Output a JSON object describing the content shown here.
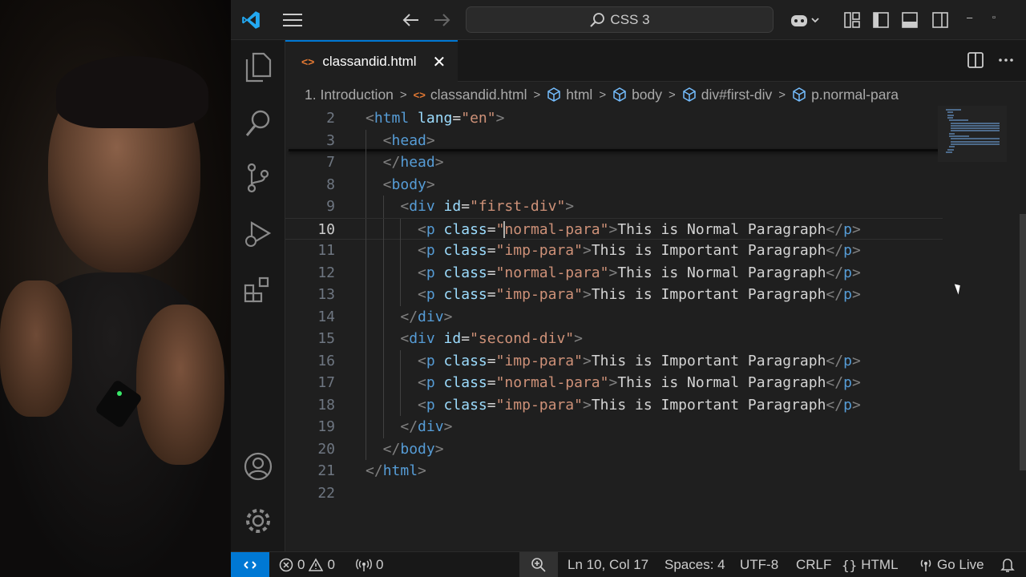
{
  "titlebar": {
    "search_text": "CSS 3"
  },
  "tab": {
    "filename": "classandid.html",
    "close_glyph": "✕"
  },
  "breadcrumb": {
    "folder": "1. Introduction",
    "file": "classandid.html",
    "items": [
      "html",
      "body",
      "div#first-div",
      "p.normal-para"
    ]
  },
  "editor": {
    "current_line": 10,
    "lines": [
      {
        "n": "2",
        "indent": 0,
        "tokens": [
          [
            "b",
            "<"
          ],
          [
            "t",
            "html"
          ],
          [
            "a",
            " lang"
          ],
          [
            "x",
            "="
          ],
          [
            "s",
            "\"en\""
          ],
          [
            "b",
            ">"
          ]
        ]
      },
      {
        "n": "3",
        "indent": 1,
        "tokens": [
          [
            "b",
            "<"
          ],
          [
            "t",
            "head"
          ],
          [
            "b",
            ">"
          ]
        ]
      },
      {
        "n": "7",
        "indent": 1,
        "tokens": [
          [
            "b",
            "</"
          ],
          [
            "t",
            "head"
          ],
          [
            "b",
            ">"
          ]
        ]
      },
      {
        "n": "8",
        "indent": 1,
        "tokens": [
          [
            "b",
            "<"
          ],
          [
            "t",
            "body"
          ],
          [
            "b",
            ">"
          ]
        ]
      },
      {
        "n": "9",
        "indent": 2,
        "tokens": [
          [
            "b",
            "<"
          ],
          [
            "t",
            "div"
          ],
          [
            "a",
            " id"
          ],
          [
            "x",
            "="
          ],
          [
            "s",
            "\"first-div\""
          ],
          [
            "b",
            ">"
          ]
        ]
      },
      {
        "n": "10",
        "indent": 3,
        "tokens": [
          [
            "b",
            "<"
          ],
          [
            "t",
            "p"
          ],
          [
            "a",
            " class"
          ],
          [
            "x",
            "="
          ],
          [
            "s",
            "\""
          ],
          [
            "c",
            ""
          ],
          [
            "s",
            "normal-para\""
          ],
          [
            "b",
            ">"
          ],
          [
            "x",
            "This is Normal Paragraph"
          ],
          [
            "b",
            "</"
          ],
          [
            "t",
            "p"
          ],
          [
            "b",
            ">"
          ]
        ]
      },
      {
        "n": "11",
        "indent": 3,
        "tokens": [
          [
            "b",
            "<"
          ],
          [
            "t",
            "p"
          ],
          [
            "a",
            " class"
          ],
          [
            "x",
            "="
          ],
          [
            "s",
            "\"imp-para\""
          ],
          [
            "b",
            ">"
          ],
          [
            "x",
            "This is Important Paragraph"
          ],
          [
            "b",
            "</"
          ],
          [
            "t",
            "p"
          ],
          [
            "b",
            ">"
          ]
        ]
      },
      {
        "n": "12",
        "indent": 3,
        "tokens": [
          [
            "b",
            "<"
          ],
          [
            "t",
            "p"
          ],
          [
            "a",
            " class"
          ],
          [
            "x",
            "="
          ],
          [
            "s",
            "\"normal-para\""
          ],
          [
            "b",
            ">"
          ],
          [
            "x",
            "This is Normal Paragraph"
          ],
          [
            "b",
            "</"
          ],
          [
            "t",
            "p"
          ],
          [
            "b",
            ">"
          ]
        ]
      },
      {
        "n": "13",
        "indent": 3,
        "tokens": [
          [
            "b",
            "<"
          ],
          [
            "t",
            "p"
          ],
          [
            "a",
            " class"
          ],
          [
            "x",
            "="
          ],
          [
            "s",
            "\"imp-para\""
          ],
          [
            "b",
            ">"
          ],
          [
            "x",
            "This is Important Paragraph"
          ],
          [
            "b",
            "</"
          ],
          [
            "t",
            "p"
          ],
          [
            "b",
            ">"
          ]
        ]
      },
      {
        "n": "14",
        "indent": 2,
        "tokens": [
          [
            "b",
            "</"
          ],
          [
            "t",
            "div"
          ],
          [
            "b",
            ">"
          ]
        ]
      },
      {
        "n": "15",
        "indent": 2,
        "tokens": [
          [
            "b",
            "<"
          ],
          [
            "t",
            "div"
          ],
          [
            "a",
            " id"
          ],
          [
            "x",
            "="
          ],
          [
            "s",
            "\"second-div\""
          ],
          [
            "b",
            ">"
          ]
        ]
      },
      {
        "n": "16",
        "indent": 3,
        "tokens": [
          [
            "b",
            "<"
          ],
          [
            "t",
            "p"
          ],
          [
            "a",
            " class"
          ],
          [
            "x",
            "="
          ],
          [
            "s",
            "\"imp-para\""
          ],
          [
            "b",
            ">"
          ],
          [
            "x",
            "This is Important Paragraph"
          ],
          [
            "b",
            "</"
          ],
          [
            "t",
            "p"
          ],
          [
            "b",
            ">"
          ]
        ]
      },
      {
        "n": "17",
        "indent": 3,
        "tokens": [
          [
            "b",
            "<"
          ],
          [
            "t",
            "p"
          ],
          [
            "a",
            " class"
          ],
          [
            "x",
            "="
          ],
          [
            "s",
            "\"normal-para\""
          ],
          [
            "b",
            ">"
          ],
          [
            "x",
            "This is Normal Paragraph"
          ],
          [
            "b",
            "</"
          ],
          [
            "t",
            "p"
          ],
          [
            "b",
            ">"
          ]
        ]
      },
      {
        "n": "18",
        "indent": 3,
        "tokens": [
          [
            "b",
            "<"
          ],
          [
            "t",
            "p"
          ],
          [
            "a",
            " class"
          ],
          [
            "x",
            "="
          ],
          [
            "s",
            "\"imp-para\""
          ],
          [
            "b",
            ">"
          ],
          [
            "x",
            "This is Important Paragraph"
          ],
          [
            "b",
            "</"
          ],
          [
            "t",
            "p"
          ],
          [
            "b",
            ">"
          ]
        ]
      },
      {
        "n": "19",
        "indent": 2,
        "tokens": [
          [
            "b",
            "</"
          ],
          [
            "t",
            "div"
          ],
          [
            "b",
            ">"
          ]
        ]
      },
      {
        "n": "20",
        "indent": 1,
        "tokens": [
          [
            "b",
            "</"
          ],
          [
            "t",
            "body"
          ],
          [
            "b",
            ">"
          ]
        ]
      },
      {
        "n": "21",
        "indent": 0,
        "tokens": [
          [
            "b",
            "</"
          ],
          [
            "t",
            "html"
          ],
          [
            "b",
            ">"
          ]
        ]
      },
      {
        "n": "22",
        "indent": 0,
        "tokens": []
      }
    ]
  },
  "statusbar": {
    "errors": "0",
    "warnings": "0",
    "ports": "0",
    "position": "Ln 10, Col 17",
    "spaces": "Spaces: 4",
    "encoding": "UTF-8",
    "eol": "CRLF",
    "language": "HTML",
    "go_live": "Go Live"
  },
  "icons": [
    "vscode-logo-icon",
    "menu-icon",
    "back-arrow-icon",
    "forward-arrow-icon",
    "search-icon",
    "copilot-icon",
    "layout-icon",
    "explorer-icon",
    "source-control-icon",
    "run-debug-icon",
    "extensions-icon",
    "account-icon",
    "settings-gear-icon",
    "split-editor-icon",
    "more-actions-icon",
    "html-file-icon",
    "box-icon",
    "error-icon",
    "warning-icon",
    "broadcast-icon",
    "zoom-icon",
    "braces-icon",
    "bell-icon"
  ],
  "colors": {
    "accent": "#0078d4",
    "tag": "#569cd6",
    "attribute": "#9cdcfe",
    "string": "#ce9178",
    "html_file_icon": "#e37933"
  }
}
